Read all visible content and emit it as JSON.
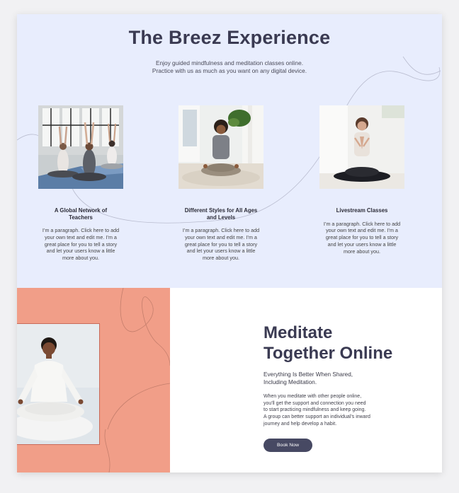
{
  "hero": {
    "title": "The Breez Experience",
    "subtitle_line1": "Enjoy guided mindfulness and meditation classes online.",
    "subtitle_line2": "Practice with us as much as you want on any digital device."
  },
  "cards": [
    {
      "title": "A Global Network of Teachers",
      "body": "I’m a paragraph. Click here to add your own text and edit me. I’m a great place for you to tell a story and let your users know a little more about you.",
      "image_icon": "yoga-class-photo"
    },
    {
      "title": "Different Styles for All Ages and Levels",
      "body": "I’m a paragraph. Click here to add your own text and edit me. I’m a great place for you to tell a story and let your users know a little more about you.",
      "image_icon": "seated-meditation-photo"
    },
    {
      "title": "Livestream Classes",
      "body": "I’m a paragraph. Click here to add your own text and edit me. I’m a great place for you to tell a story and let your users know a little more about you.",
      "image_icon": "prayer-pose-photo"
    }
  ],
  "meditate": {
    "title_line1": "Meditate",
    "title_line2": "Together Online",
    "subtitle_line1": "Everything Is Better When Shared,",
    "subtitle_line2": "Including Meditation.",
    "body_lines": [
      "When you meditate with other people online,",
      "you'll get the support and connection you need",
      "to start practicing mindfulness and keep going.",
      "A group can better support an individual’s inward",
      "journey and help develop a habit."
    ],
    "button_label": "Book Now",
    "image_icon": "smiling-meditator-photo"
  },
  "colors": {
    "hero_bg": "#e8edfd",
    "accent_coral": "#f19e88",
    "heading": "#3a3a52",
    "button": "#474963"
  }
}
